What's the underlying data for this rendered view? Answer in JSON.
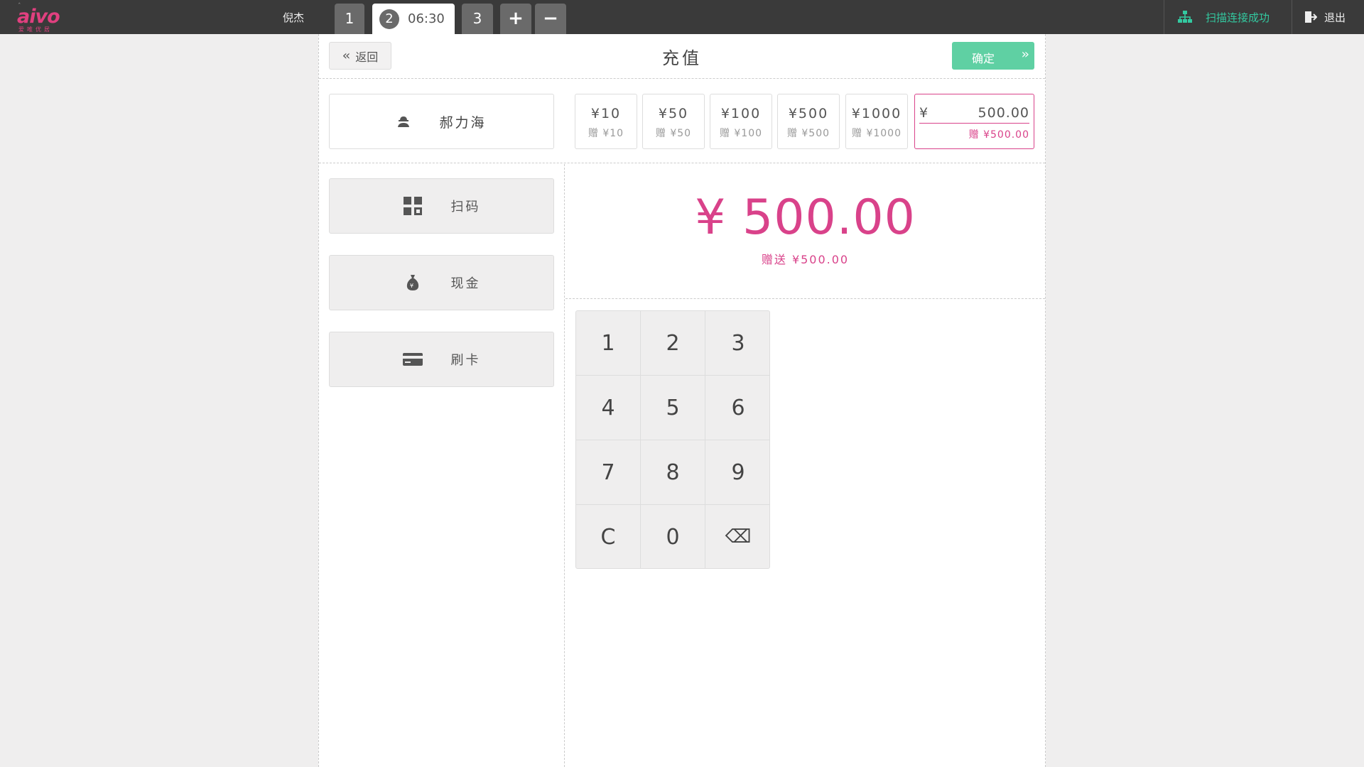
{
  "topbar": {
    "logo_text": "aivo",
    "logo_sub": "爱唯优居",
    "user_name": "倪杰",
    "tabs": [
      {
        "label": "1"
      },
      {
        "label": "2",
        "time": "06:30"
      },
      {
        "label": "3"
      }
    ],
    "add_tab": "+",
    "remove_tab": "−",
    "connection_status": "扫描连接成功",
    "logout_label": "退出",
    "status_color": "#33c9a0"
  },
  "header": {
    "back_label": "返回",
    "title": "充值",
    "confirm_label": "确定",
    "confirm_color": "#5fd0a3"
  },
  "member": {
    "name": "郝力海",
    "icon": "user-icon"
  },
  "amount_options": [
    {
      "value": "¥10",
      "gift": "赠 ¥10"
    },
    {
      "value": "¥50",
      "gift": "赠 ¥50"
    },
    {
      "value": "¥100",
      "gift": "赠 ¥100"
    },
    {
      "value": "¥500",
      "gift": "赠 ¥500"
    },
    {
      "value": "¥1000",
      "gift": "赠 ¥1000"
    }
  ],
  "custom_amount": {
    "currency": "¥",
    "value": "500.00",
    "gift": "赠 ¥500.00",
    "accent_color": "#d9428a"
  },
  "payment_methods": [
    {
      "label": "扫码",
      "icon": "qr-code-icon"
    },
    {
      "label": "现金",
      "icon": "money-bag-icon"
    },
    {
      "label": "刷卡",
      "icon": "credit-card-icon"
    }
  ],
  "display": {
    "amount": "¥ 500.00",
    "gift": "赠送 ¥500.00"
  },
  "keypad": {
    "keys": [
      "1",
      "2",
      "3",
      "4",
      "5",
      "6",
      "7",
      "8",
      "9",
      "C",
      "0",
      "⌫"
    ]
  }
}
